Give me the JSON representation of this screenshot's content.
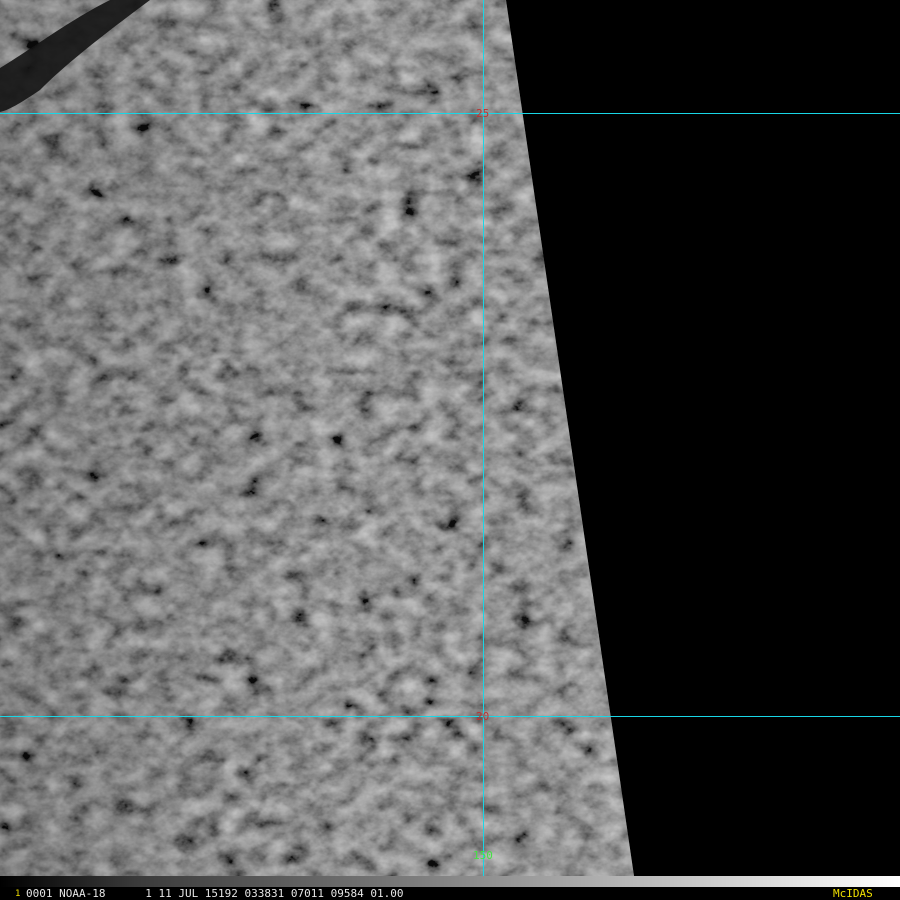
{
  "frame": {
    "number": "1",
    "info_text": "0001 NOAA-18      1 11 JUL 15192 033831 07011 09584 01.00",
    "brand": "McIDAS"
  },
  "grid": {
    "line_color": "#19d6e6",
    "latitudes": [
      {
        "label": "25"
      },
      {
        "label": "20"
      }
    ],
    "longitudes": [
      {
        "label": "150"
      }
    ],
    "latitude_label_color": "#b83434",
    "longitude_label_color": "#41e341"
  },
  "imagery": {
    "satellite": "NOAA-18",
    "mode": "grayscale cloud imagery",
    "space_color": "#000000"
  }
}
